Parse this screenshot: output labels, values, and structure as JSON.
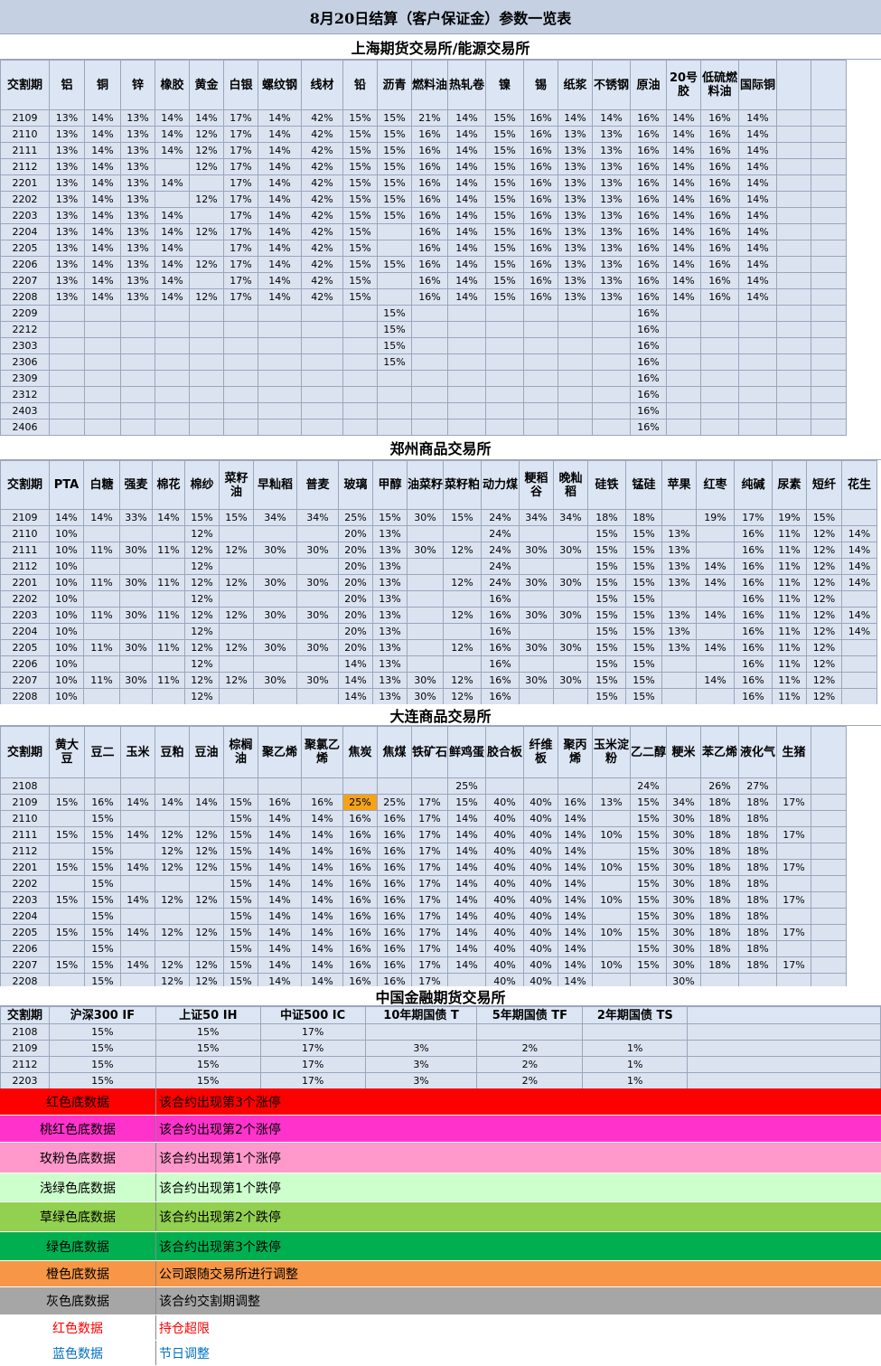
{
  "title": "8月20日结算（客户保证金）参数一览表",
  "shfe": {
    "name": "上海期货交易所/能源交易所",
    "headers": [
      "交割期",
      "铝",
      "铜",
      "锌",
      "橡胶",
      "黄金",
      "白银",
      "螺纹钢",
      "线材",
      "铅",
      "沥青",
      "燃料油",
      "热轧卷",
      "镍",
      "锡",
      "纸浆",
      "不锈钢",
      "原油",
      "20号胶",
      "低硫燃料油",
      "国际铜",
      "",
      ""
    ],
    "rows": [
      [
        "2109",
        "13%",
        "14%",
        "13%",
        "14%",
        "14%",
        "17%",
        "14%",
        "42%",
        "15%",
        "15%",
        "21%",
        "14%",
        "15%",
        "16%",
        "14%",
        "14%",
        "16%",
        "14%",
        "16%",
        "14%",
        "",
        ""
      ],
      [
        "2110",
        "13%",
        "14%",
        "13%",
        "14%",
        "12%",
        "17%",
        "14%",
        "42%",
        "15%",
        "15%",
        "16%",
        "14%",
        "15%",
        "16%",
        "13%",
        "13%",
        "16%",
        "14%",
        "16%",
        "14%",
        "",
        ""
      ],
      [
        "2111",
        "13%",
        "14%",
        "13%",
        "14%",
        "12%",
        "17%",
        "14%",
        "42%",
        "15%",
        "15%",
        "16%",
        "14%",
        "15%",
        "16%",
        "13%",
        "13%",
        "16%",
        "14%",
        "16%",
        "14%",
        "",
        ""
      ],
      [
        "2112",
        "13%",
        "14%",
        "13%",
        "",
        "12%",
        "17%",
        "14%",
        "42%",
        "15%",
        "15%",
        "16%",
        "14%",
        "15%",
        "16%",
        "13%",
        "13%",
        "16%",
        "14%",
        "16%",
        "14%",
        "",
        ""
      ],
      [
        "2201",
        "13%",
        "14%",
        "13%",
        "14%",
        "",
        "17%",
        "14%",
        "42%",
        "15%",
        "15%",
        "16%",
        "14%",
        "15%",
        "16%",
        "13%",
        "13%",
        "16%",
        "14%",
        "16%",
        "14%",
        "",
        ""
      ],
      [
        "2202",
        "13%",
        "14%",
        "13%",
        "",
        "12%",
        "17%",
        "14%",
        "42%",
        "15%",
        "15%",
        "16%",
        "14%",
        "15%",
        "16%",
        "13%",
        "13%",
        "16%",
        "14%",
        "16%",
        "14%",
        "",
        ""
      ],
      [
        "2203",
        "13%",
        "14%",
        "13%",
        "14%",
        "",
        "17%",
        "14%",
        "42%",
        "15%",
        "15%",
        "16%",
        "14%",
        "15%",
        "16%",
        "13%",
        "13%",
        "16%",
        "14%",
        "16%",
        "14%",
        "",
        ""
      ],
      [
        "2204",
        "13%",
        "14%",
        "13%",
        "14%",
        "12%",
        "17%",
        "14%",
        "42%",
        "15%",
        "",
        "16%",
        "14%",
        "15%",
        "16%",
        "13%",
        "13%",
        "16%",
        "14%",
        "16%",
        "14%",
        "",
        ""
      ],
      [
        "2205",
        "13%",
        "14%",
        "13%",
        "14%",
        "",
        "17%",
        "14%",
        "42%",
        "15%",
        "",
        "16%",
        "14%",
        "15%",
        "16%",
        "13%",
        "13%",
        "16%",
        "14%",
        "16%",
        "14%",
        "",
        ""
      ],
      [
        "2206",
        "13%",
        "14%",
        "13%",
        "14%",
        "12%",
        "17%",
        "14%",
        "42%",
        "15%",
        "15%",
        "16%",
        "14%",
        "15%",
        "16%",
        "13%",
        "13%",
        "16%",
        "14%",
        "16%",
        "14%",
        "",
        ""
      ],
      [
        "2207",
        "13%",
        "14%",
        "13%",
        "14%",
        "",
        "17%",
        "14%",
        "42%",
        "15%",
        "",
        "16%",
        "14%",
        "15%",
        "16%",
        "13%",
        "13%",
        "16%",
        "14%",
        "16%",
        "14%",
        "",
        ""
      ],
      [
        "2208",
        "13%",
        "14%",
        "13%",
        "14%",
        "12%",
        "17%",
        "14%",
        "42%",
        "15%",
        "",
        "16%",
        "14%",
        "15%",
        "16%",
        "13%",
        "13%",
        "16%",
        "14%",
        "16%",
        "14%",
        "",
        ""
      ],
      [
        "2209",
        "",
        "",
        "",
        "",
        "",
        "",
        "",
        "",
        "",
        "15%",
        "",
        "",
        "",
        "",
        "",
        "",
        "16%",
        "",
        "",
        "",
        "",
        ""
      ],
      [
        "2212",
        "",
        "",
        "",
        "",
        "",
        "",
        "",
        "",
        "",
        "15%",
        "",
        "",
        "",
        "",
        "",
        "",
        "16%",
        "",
        "",
        "",
        "",
        ""
      ],
      [
        "2303",
        "",
        "",
        "",
        "",
        "",
        "",
        "",
        "",
        "",
        "15%",
        "",
        "",
        "",
        "",
        "",
        "",
        "16%",
        "",
        "",
        "",
        "",
        ""
      ],
      [
        "2306",
        "",
        "",
        "",
        "",
        "",
        "",
        "",
        "",
        "",
        "15%",
        "",
        "",
        "",
        "",
        "",
        "",
        "16%",
        "",
        "",
        "",
        "",
        ""
      ],
      [
        "2309",
        "",
        "",
        "",
        "",
        "",
        "",
        "",
        "",
        "",
        "",
        "",
        "",
        "",
        "",
        "",
        "",
        "16%",
        "",
        "",
        "",
        "",
        ""
      ],
      [
        "2312",
        "",
        "",
        "",
        "",
        "",
        "",
        "",
        "",
        "",
        "",
        "",
        "",
        "",
        "",
        "",
        "",
        "16%",
        "",
        "",
        "",
        "",
        ""
      ],
      [
        "2403",
        "",
        "",
        "",
        "",
        "",
        "",
        "",
        "",
        "",
        "",
        "",
        "",
        "",
        "",
        "",
        "",
        "16%",
        "",
        "",
        "",
        "",
        ""
      ],
      [
        "2406",
        "",
        "",
        "",
        "",
        "",
        "",
        "",
        "",
        "",
        "",
        "",
        "",
        "",
        "",
        "",
        "",
        "16%",
        "",
        "",
        "",
        "",
        ""
      ]
    ]
  },
  "czce": {
    "name": "郑州商品交易所",
    "headers": [
      "交割期",
      "PTA",
      "白糖",
      "强麦",
      "棉花",
      "棉纱",
      "菜籽油",
      "早籼稻",
      "普麦",
      "玻璃",
      "甲醇",
      "油菜籽",
      "菜籽粕",
      "动力煤",
      "粳稻谷",
      "晚籼稻",
      "硅铁",
      "锰硅",
      "苹果",
      "红枣",
      "纯碱",
      "尿素",
      "短纤",
      "花生"
    ],
    "rows": [
      [
        "2109",
        "14%",
        "14%",
        "33%",
        "14%",
        "15%",
        "15%",
        "34%",
        "34%",
        "25%",
        "15%",
        "30%",
        "15%",
        "24%",
        "34%",
        "34%",
        "18%",
        "18%",
        "",
        "19%",
        "17%",
        "19%",
        "15%",
        ""
      ],
      [
        "2110",
        "10%",
        "",
        "",
        "",
        "12%",
        "",
        "",
        "",
        "20%",
        "13%",
        "",
        "",
        "24%",
        "",
        "",
        "15%",
        "15%",
        "13%",
        "",
        "16%",
        "11%",
        "12%",
        "14%"
      ],
      [
        "2111",
        "10%",
        "11%",
        "30%",
        "11%",
        "12%",
        "12%",
        "30%",
        "30%",
        "20%",
        "13%",
        "30%",
        "12%",
        "24%",
        "30%",
        "30%",
        "15%",
        "15%",
        "13%",
        "",
        "16%",
        "11%",
        "12%",
        "14%"
      ],
      [
        "2112",
        "10%",
        "",
        "",
        "",
        "12%",
        "",
        "",
        "",
        "20%",
        "13%",
        "",
        "",
        "24%",
        "",
        "",
        "15%",
        "15%",
        "13%",
        "14%",
        "16%",
        "11%",
        "12%",
        "14%"
      ],
      [
        "2201",
        "10%",
        "11%",
        "30%",
        "11%",
        "12%",
        "12%",
        "30%",
        "30%",
        "20%",
        "13%",
        "",
        "12%",
        "24%",
        "30%",
        "30%",
        "15%",
        "15%",
        "13%",
        "14%",
        "16%",
        "11%",
        "12%",
        "14%"
      ],
      [
        "2202",
        "10%",
        "",
        "",
        "",
        "12%",
        "",
        "",
        "",
        "20%",
        "13%",
        "",
        "",
        "16%",
        "",
        "",
        "15%",
        "15%",
        "",
        "",
        "16%",
        "11%",
        "12%",
        ""
      ],
      [
        "2203",
        "10%",
        "11%",
        "30%",
        "11%",
        "12%",
        "12%",
        "30%",
        "30%",
        "20%",
        "13%",
        "",
        "12%",
        "16%",
        "30%",
        "30%",
        "15%",
        "15%",
        "13%",
        "14%",
        "16%",
        "11%",
        "12%",
        "14%"
      ],
      [
        "2204",
        "10%",
        "",
        "",
        "",
        "12%",
        "",
        "",
        "",
        "20%",
        "13%",
        "",
        "",
        "16%",
        "",
        "",
        "15%",
        "15%",
        "13%",
        "",
        "16%",
        "11%",
        "12%",
        "14%"
      ],
      [
        "2205",
        "10%",
        "11%",
        "30%",
        "11%",
        "12%",
        "12%",
        "30%",
        "30%",
        "20%",
        "13%",
        "",
        "12%",
        "16%",
        "30%",
        "30%",
        "15%",
        "15%",
        "13%",
        "14%",
        "16%",
        "11%",
        "12%",
        ""
      ],
      [
        "2206",
        "10%",
        "",
        "",
        "",
        "12%",
        "",
        "",
        "",
        "14%",
        "13%",
        "",
        "",
        "16%",
        "",
        "",
        "15%",
        "15%",
        "",
        "",
        "16%",
        "11%",
        "12%",
        ""
      ],
      [
        "2207",
        "10%",
        "11%",
        "30%",
        "11%",
        "12%",
        "12%",
        "30%",
        "30%",
        "14%",
        "13%",
        "30%",
        "12%",
        "16%",
        "30%",
        "30%",
        "15%",
        "15%",
        "",
        "14%",
        "16%",
        "11%",
        "12%",
        ""
      ],
      [
        "2208",
        "10%",
        "",
        "",
        "",
        "12%",
        "",
        "",
        "",
        "14%",
        "13%",
        "30%",
        "12%",
        "16%",
        "",
        "",
        "15%",
        "15%",
        "",
        "",
        "16%",
        "11%",
        "12%",
        ""
      ]
    ]
  },
  "dce": {
    "name": "大连商品交易所",
    "headers": [
      "交割期",
      "黄大豆",
      "豆二",
      "玉米",
      "豆粕",
      "豆油",
      "棕榈油",
      "聚乙烯",
      "聚氯乙烯",
      "焦炭",
      "焦煤",
      "铁矿石",
      "鲜鸡蛋",
      "胶合板",
      "纤维板",
      "聚丙烯",
      "玉米淀粉",
      "乙二醇",
      "粳米",
      "苯乙烯",
      "液化气",
      "生猪",
      "",
      ""
    ],
    "rows": [
      [
        "2108",
        "",
        "",
        "",
        "",
        "",
        "",
        "",
        "",
        "",
        "",
        "",
        "25%",
        "",
        "",
        "",
        "",
        "24%",
        "",
        "26%",
        "27%",
        "",
        "",
        ""
      ],
      [
        "2109",
        "15%",
        "16%",
        "14%",
        "14%",
        "14%",
        "15%",
        "16%",
        "16%",
        "25%",
        "25%",
        "17%",
        "15%",
        "40%",
        "40%",
        "16%",
        "13%",
        "15%",
        "34%",
        "18%",
        "18%",
        "17%",
        "",
        ""
      ],
      [
        "2110",
        "",
        "15%",
        "",
        "",
        "",
        "15%",
        "14%",
        "14%",
        "16%",
        "16%",
        "17%",
        "14%",
        "40%",
        "40%",
        "14%",
        "",
        "15%",
        "30%",
        "18%",
        "18%",
        "",
        "",
        ""
      ],
      [
        "2111",
        "15%",
        "15%",
        "14%",
        "12%",
        "12%",
        "15%",
        "14%",
        "14%",
        "16%",
        "16%",
        "17%",
        "14%",
        "40%",
        "40%",
        "14%",
        "10%",
        "15%",
        "30%",
        "18%",
        "18%",
        "17%",
        "",
        ""
      ],
      [
        "2112",
        "",
        "15%",
        "",
        "12%",
        "12%",
        "15%",
        "14%",
        "14%",
        "16%",
        "16%",
        "17%",
        "14%",
        "40%",
        "40%",
        "14%",
        "",
        "15%",
        "30%",
        "18%",
        "18%",
        "",
        "",
        ""
      ],
      [
        "2201",
        "15%",
        "15%",
        "14%",
        "12%",
        "12%",
        "15%",
        "14%",
        "14%",
        "16%",
        "16%",
        "17%",
        "14%",
        "40%",
        "40%",
        "14%",
        "10%",
        "15%",
        "30%",
        "18%",
        "18%",
        "17%",
        "",
        ""
      ],
      [
        "2202",
        "",
        "15%",
        "",
        "",
        "",
        "15%",
        "14%",
        "14%",
        "16%",
        "16%",
        "17%",
        "14%",
        "40%",
        "40%",
        "14%",
        "",
        "15%",
        "30%",
        "18%",
        "18%",
        "",
        "",
        ""
      ],
      [
        "2203",
        "15%",
        "15%",
        "14%",
        "12%",
        "12%",
        "15%",
        "14%",
        "14%",
        "16%",
        "16%",
        "17%",
        "14%",
        "40%",
        "40%",
        "14%",
        "10%",
        "15%",
        "30%",
        "18%",
        "18%",
        "17%",
        "",
        ""
      ],
      [
        "2204",
        "",
        "15%",
        "",
        "",
        "",
        "15%",
        "14%",
        "14%",
        "16%",
        "16%",
        "17%",
        "14%",
        "40%",
        "40%",
        "14%",
        "",
        "15%",
        "30%",
        "18%",
        "18%",
        "",
        "",
        ""
      ],
      [
        "2205",
        "15%",
        "15%",
        "14%",
        "12%",
        "12%",
        "15%",
        "14%",
        "14%",
        "16%",
        "16%",
        "17%",
        "14%",
        "40%",
        "40%",
        "14%",
        "10%",
        "15%",
        "30%",
        "18%",
        "18%",
        "17%",
        "",
        ""
      ],
      [
        "2206",
        "",
        "15%",
        "",
        "",
        "",
        "15%",
        "14%",
        "14%",
        "16%",
        "16%",
        "17%",
        "14%",
        "40%",
        "40%",
        "14%",
        "",
        "15%",
        "30%",
        "18%",
        "18%",
        "",
        "",
        ""
      ],
      [
        "2207",
        "15%",
        "15%",
        "14%",
        "12%",
        "12%",
        "15%",
        "14%",
        "14%",
        "16%",
        "16%",
        "17%",
        "14%",
        "40%",
        "40%",
        "14%",
        "10%",
        "15%",
        "30%",
        "18%",
        "18%",
        "17%",
        "",
        ""
      ],
      [
        "2208",
        "",
        "15%",
        "",
        "12%",
        "12%",
        "15%",
        "14%",
        "14%",
        "16%",
        "16%",
        "17%",
        "",
        "40%",
        "40%",
        "14%",
        "",
        "",
        "30%",
        "",
        "",
        "",
        "",
        ""
      ]
    ],
    "highlight": {
      "row": 1,
      "col": 9,
      "color": "#f4a21a"
    }
  },
  "cffex": {
    "name": "中国金融期货交易所",
    "headers": [
      "交割期",
      "沪深300  IF",
      "上证50  IH",
      "中证500  IC",
      "10年期国债  T",
      "5年期国债  TF",
      "2年期国债  TS",
      ""
    ],
    "rows": [
      [
        "2108",
        "15%",
        "15%",
        "17%",
        "",
        "",
        "",
        ""
      ],
      [
        "2109",
        "15%",
        "15%",
        "17%",
        "3%",
        "2%",
        "1%",
        ""
      ],
      [
        "2112",
        "15%",
        "15%",
        "17%",
        "3%",
        "2%",
        "1%",
        ""
      ],
      [
        "2203",
        "15%",
        "15%",
        "17%",
        "3%",
        "2%",
        "1%",
        ""
      ]
    ]
  },
  "legend": [
    {
      "label": "红色底数据",
      "desc": "该合约出现第3个涨停",
      "bg": "#ff0000",
      "fg": "#000000",
      "h": 30
    },
    {
      "label": "桃红色底数据",
      "desc": "该合约出现第2个涨停",
      "bg": "#ff33cc",
      "fg": "#000000",
      "h": 30
    },
    {
      "label": "玫粉色底数据",
      "desc": "该合约出现第1个涨停",
      "bg": "#ff99cc",
      "fg": "#000000",
      "h": 34
    },
    {
      "label": "浅绿色底数据",
      "desc": "该合约出现第1个跌停",
      "bg": "#ccffcc",
      "fg": "#000000",
      "h": 32
    },
    {
      "label": "草绿色底数据",
      "desc": "该合约出现第2个跌停",
      "bg": "#92d050",
      "fg": "#000000",
      "h": 33
    },
    {
      "label": "绿色底数据",
      "desc": "该合约出现第3个跌停",
      "bg": "#00b050",
      "fg": "#000000",
      "h": 32
    },
    {
      "label": "橙色底数据",
      "desc": "公司跟随交易所进行调整",
      "bg": "#f79646",
      "fg": "#000000",
      "h": 29
    },
    {
      "label": "灰色底数据",
      "desc": "该合约交割期调整",
      "bg": "#a6a6a6",
      "fg": "#000000",
      "h": 31
    },
    {
      "label": "红色数据",
      "desc": "持仓超限",
      "bg": "#ffffff",
      "fg": "#ff0000",
      "h": 28
    },
    {
      "label": "蓝色数据",
      "desc": "节日调整",
      "bg": "#ffffff",
      "fg": "#0070c0",
      "h": 28
    }
  ]
}
